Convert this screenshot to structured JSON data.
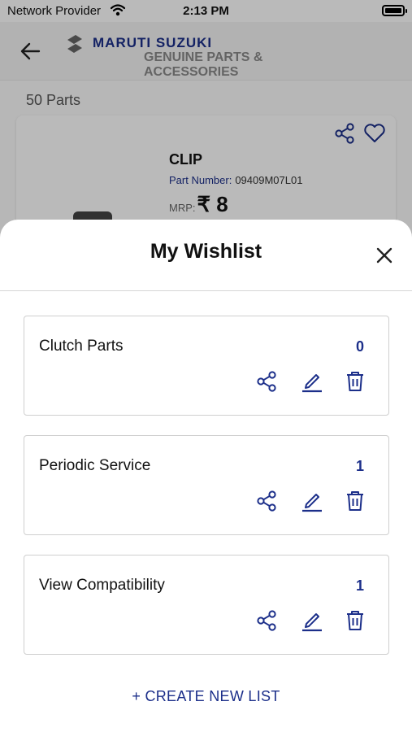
{
  "status_bar": {
    "carrier": "Network Provider",
    "time": "2:13 PM"
  },
  "header": {
    "brand": "MARUTI SUZUKI",
    "tagline": "GENUINE PARTS & ACCESSORIES",
    "icons": {
      "back": "arrow-left-icon",
      "logo": "suzuki-logo"
    }
  },
  "results": {
    "count_label": "50 Parts"
  },
  "part": {
    "name": "CLIP",
    "part_number_label": "Part Number:",
    "part_number": "09409M07L01",
    "mrp_label": "MRP:",
    "price": "₹ 8"
  },
  "wishlist": {
    "title": "My Wishlist",
    "lists": [
      {
        "name": "Clutch Parts",
        "count": "0"
      },
      {
        "name": "Periodic Service",
        "count": "1"
      },
      {
        "name": "View Compatibility",
        "count": "1"
      }
    ],
    "create_label": "+ CREATE NEW LIST"
  },
  "colors": {
    "accent": "#1c2f8a",
    "border": "#cfcfcf",
    "overlay": "rgba(0,0,0,0.27)"
  }
}
